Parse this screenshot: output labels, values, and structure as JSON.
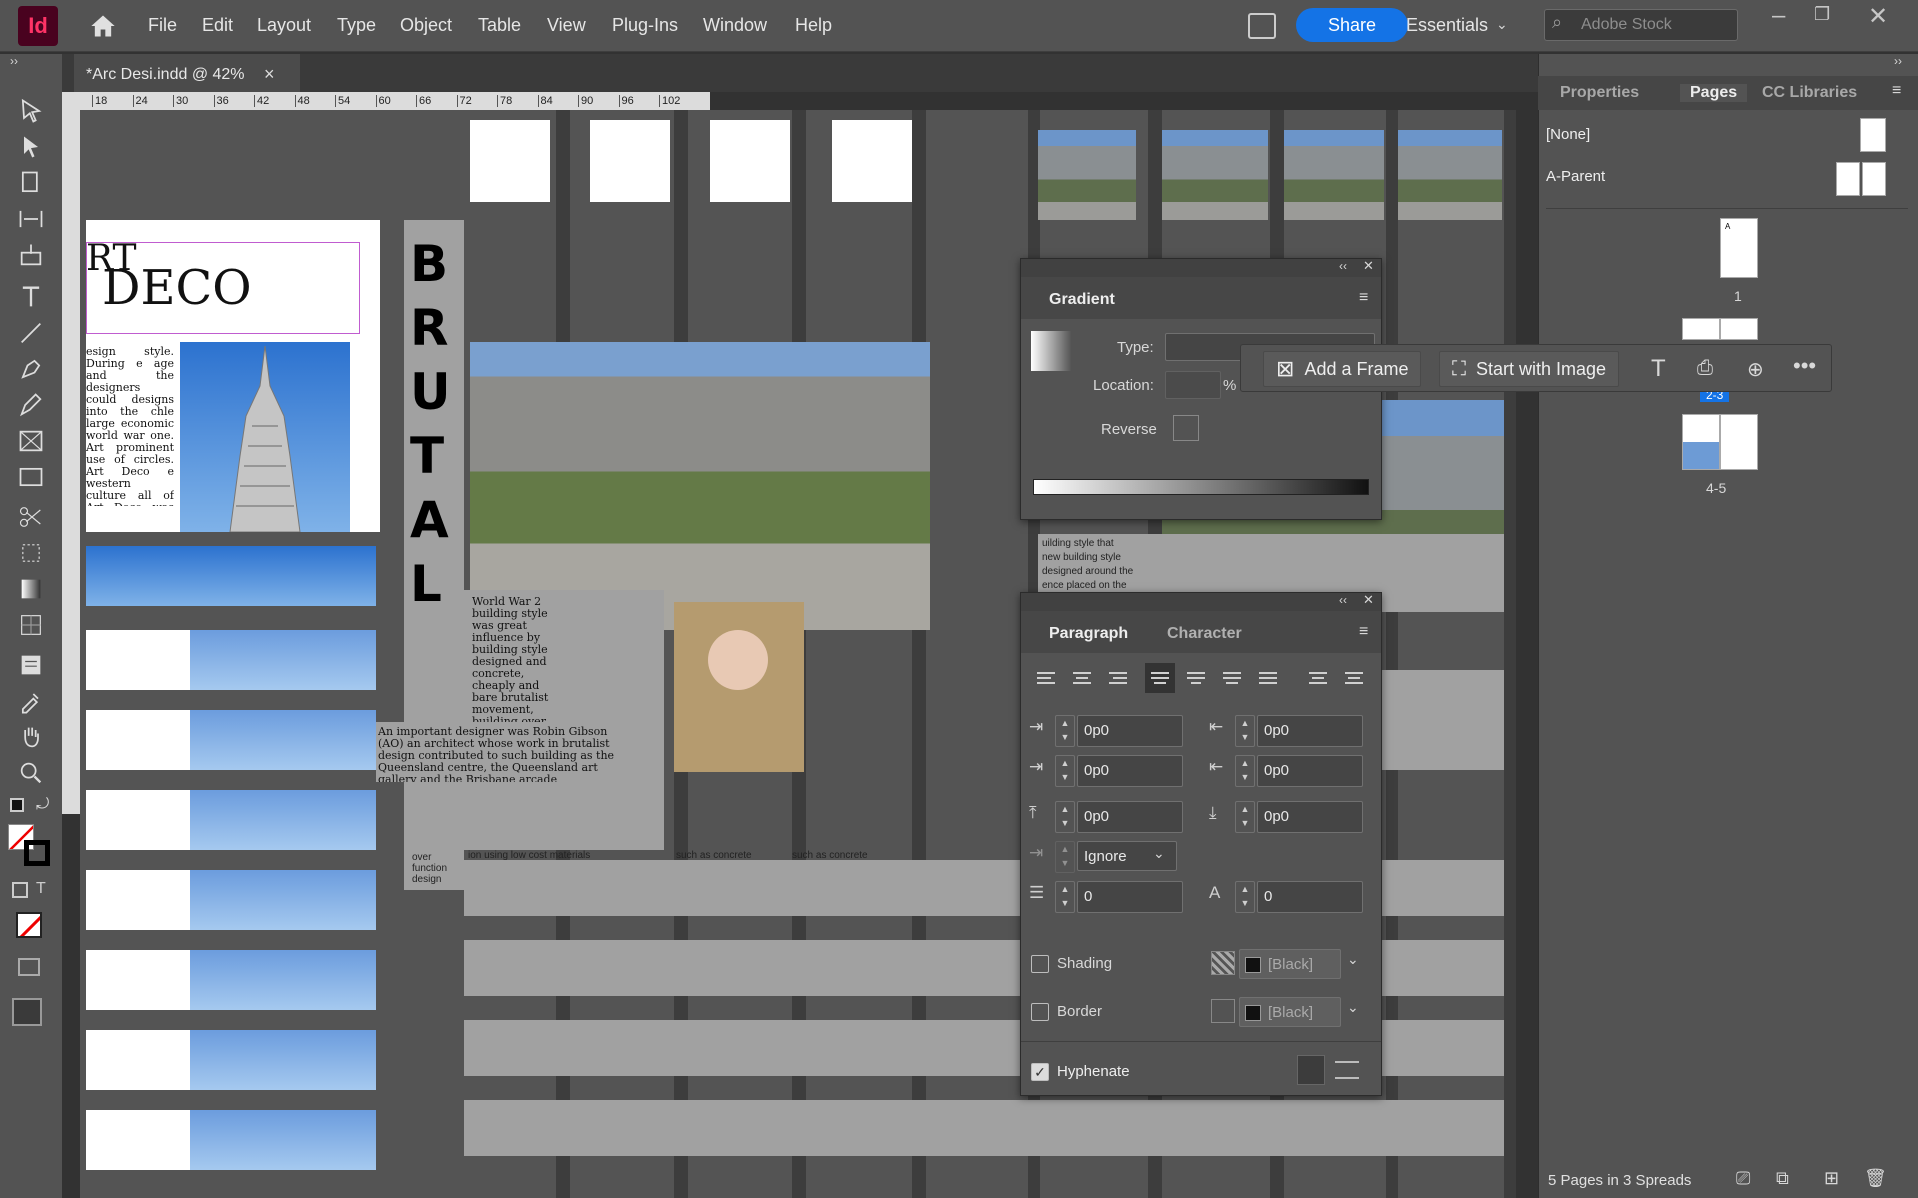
{
  "app": {
    "logo": "Id",
    "menus": [
      "File",
      "Edit",
      "Layout",
      "Type",
      "Object",
      "Table",
      "View",
      "Plug-Ins",
      "Window",
      "Help"
    ],
    "share": "Share",
    "workspace": "Essentials",
    "search_placeholder": "Adobe Stock"
  },
  "document": {
    "tab_title": "*Arc Desi.indd @ 42%",
    "close": "×"
  },
  "ruler": {
    "ticks": [
      "18",
      "24",
      "30",
      "36",
      "42",
      "48",
      "54",
      "60",
      "66",
      "72",
      "78",
      "84",
      "90",
      "96",
      "102"
    ]
  },
  "canvas": {
    "heading_top": "RT",
    "heading_bottom": "DECO",
    "vertical_word": "B R U T A L",
    "body_art_deco": "esign style. During e age and the designers could designs into the chle large economic world war one. Art prominent use of circles. Art Deco e western culture all of Art Deco was ion crafts included Art contributed to",
    "body_ww2": "World War 2 building style was great influence by building style designed and concrete, cheaply and bare brutalist movement, building over function materials such low cost materials",
    "body_gibson": "An important designer was Robin Gibson (AO) an architect whose work in brutalist design contributed to such building as the Queensland centre, the Queensland art gallery and the Brisbane arcade",
    "snip_a": "uilding style that",
    "snip_b": "new building style",
    "snip_c": "designed around the",
    "snip_d": "ence placed on the",
    "snip_e": "such as concrete",
    "snip_f": "over function design",
    "snip_g": "ion using low cost materials"
  },
  "panels": {
    "right_tabs": [
      "Properties",
      "Pages",
      "CC Libraries"
    ],
    "pages": {
      "none": "[None]",
      "parent": "A-Parent",
      "page1": "1",
      "spread1": "2-3",
      "spread2": "4-5",
      "status": "5 Pages in 3 Spreads"
    },
    "gradient": {
      "title": "Gradient",
      "type_label": "Type:",
      "location_label": "Location:",
      "percent": "%",
      "reverse": "Reverse"
    },
    "context": {
      "add_frame": "Add a Frame",
      "start_image": "Start with Image"
    },
    "paragraph": {
      "tab1": "Paragraph",
      "tab2": "Character",
      "left_indent": "0p0",
      "right_indent": "0p0",
      "first_indent": "0p0",
      "last_indent": "0p0",
      "space_before": "0p0",
      "space_after": "0p0",
      "align_to_grid": "Ignore",
      "drop_lines": "0",
      "drop_chars": "0",
      "shading": "Shading",
      "border": "Border",
      "swatch": "[Black]",
      "hyphenate": "Hyphenate"
    }
  },
  "colors": {
    "accent": "#1473e6",
    "brand": "#ff3366",
    "panel": "#535353"
  }
}
